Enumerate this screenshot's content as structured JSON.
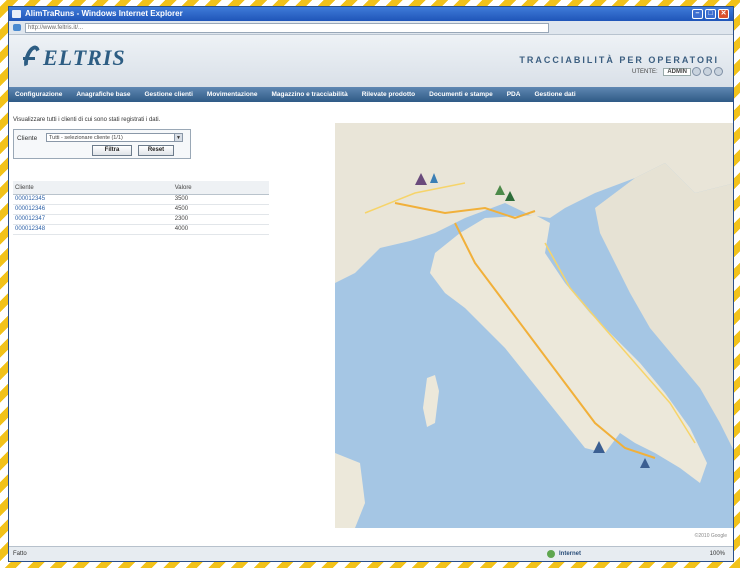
{
  "window": {
    "title": "AlimTraRuns - Windows Internet Explorer",
    "url": "http://www.feltris.it/..."
  },
  "header": {
    "brand": "ELTRIS",
    "tagline": "TRACCIABILITÀ PER OPERATORI",
    "user_label": "UTENTE:",
    "user_name": "ADMIN"
  },
  "nav": {
    "items": [
      "Configurazione",
      "Anagrafiche base",
      "Gestione clienti",
      "Movimentazione",
      "Magazzino e tracciabilità",
      "Rilevate prodotto",
      "Documenti e stampe",
      "PDA",
      "Gestione dati"
    ]
  },
  "filters": {
    "intro": "Visualizzare tutti i clienti di cui sono stati registrati i dati.",
    "label": "Cliente",
    "selected": "Tutti - selezionare cliente (1/1)",
    "filter_button": "Filtra",
    "reset_button": "Reset"
  },
  "table": {
    "headers": [
      "Cliente",
      "Valore"
    ],
    "rows": [
      [
        "000012345",
        "3500"
      ],
      [
        "000012346",
        "4500"
      ],
      [
        "000012347",
        "2300"
      ],
      [
        "000012348",
        "4000"
      ]
    ]
  },
  "map": {
    "copyright": "©2010 Google"
  },
  "status": {
    "left": "Fatto",
    "zone": "Internet",
    "zoom": "100%"
  }
}
